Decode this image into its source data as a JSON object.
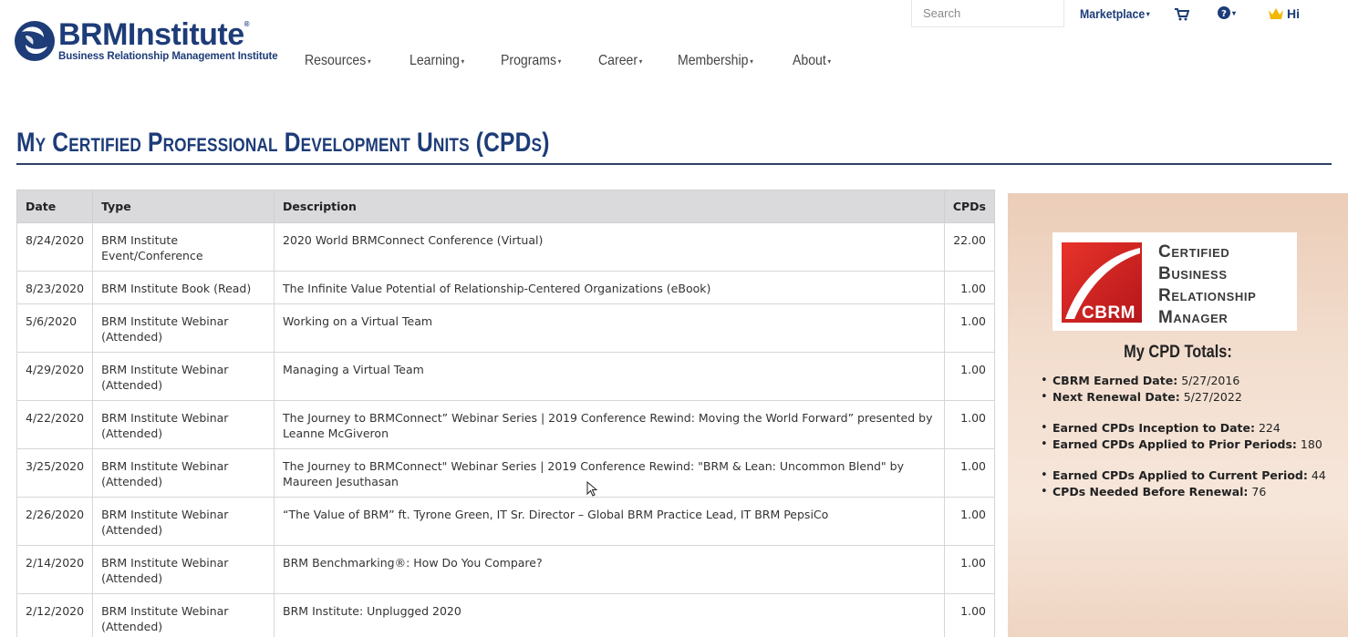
{
  "brand": {
    "name": "BRMInstitute",
    "registered": "®",
    "tagline": "Business Relationship Management Institute"
  },
  "search": {
    "placeholder": "Search"
  },
  "utility": {
    "marketplace_label": "Marketplace",
    "greeting": "Hi",
    "cart_icon": "cart-icon",
    "help_icon": "question-circle-icon",
    "crown_icon": "crown-icon"
  },
  "nav": {
    "items": [
      {
        "label": "Resources"
      },
      {
        "label": "Learning"
      },
      {
        "label": "Programs"
      },
      {
        "label": "Career"
      },
      {
        "label": "Membership"
      },
      {
        "label": "About"
      }
    ]
  },
  "page": {
    "title": "My Certified Professional Development Units (CPDs)"
  },
  "table": {
    "headers": {
      "date": "Date",
      "type": "Type",
      "description": "Description",
      "cpds": "CPDs"
    },
    "rows": [
      {
        "date": "8/24/2020",
        "type": "BRM Institute Event/Conference",
        "description": "2020 World BRMConnect Conference (Virtual)",
        "cpds": "22.00"
      },
      {
        "date": "8/23/2020",
        "type": "BRM Institute Book (Read)",
        "description": "The Infinite Value Potential of Relationship-Centered Organizations (eBook)",
        "cpds": "1.00"
      },
      {
        "date": "5/6/2020",
        "type": "BRM Institute Webinar (Attended)",
        "description": "Working on a Virtual Team",
        "cpds": "1.00"
      },
      {
        "date": "4/29/2020",
        "type": "BRM Institute Webinar (Attended)",
        "description": "Managing a Virtual Team",
        "cpds": "1.00"
      },
      {
        "date": "4/22/2020",
        "type": "BRM Institute Webinar (Attended)",
        "description": "The Journey to BRMConnect” Webinar Series | 2019 Conference Rewind: Moving the World Forward” presented by Leanne McGiveron",
        "cpds": "1.00"
      },
      {
        "date": "3/25/2020",
        "type": "BRM Institute Webinar (Attended)",
        "description": "The Journey to BRMConnect\" Webinar Series | 2019 Conference Rewind: \"BRM & Lean: Uncommon Blend\" by Maureen Jesuthasan",
        "cpds": "1.00"
      },
      {
        "date": "2/26/2020",
        "type": "BRM Institute Webinar (Attended)",
        "description": "“The Value of BRM” ft. Tyrone Green, IT Sr. Director – Global BRM Practice Lead, IT BRM PepsiCo",
        "cpds": "1.00"
      },
      {
        "date": "2/14/2020",
        "type": "BRM Institute Webinar (Attended)",
        "description": "BRM Benchmarking®: How Do You Compare?",
        "cpds": "1.00"
      },
      {
        "date": "2/12/2020",
        "type": "BRM Institute Webinar (Attended)",
        "description": "BRM Institute: Unplugged 2020",
        "cpds": "1.00"
      }
    ]
  },
  "panel": {
    "badge": {
      "mark_text": "CBRM",
      "words": [
        "Certified",
        "Business",
        "Relationship",
        "Manager"
      ]
    },
    "totals_title": "My CPD Totals:",
    "totals": [
      {
        "label": "CBRM Earned Date:",
        "value": "5/27/2016"
      },
      {
        "label": "Next Renewal Date:",
        "value": "5/27/2022"
      },
      {
        "label": "Earned CPDs Inception to Date:",
        "value": "224"
      },
      {
        "label": "Earned CPDs Applied to Prior Periods:",
        "value": "180"
      },
      {
        "label": "Earned CPDs Applied to Current Period:",
        "value": "44"
      },
      {
        "label": "CPDs Needed Before Renewal:",
        "value": "76"
      }
    ]
  }
}
